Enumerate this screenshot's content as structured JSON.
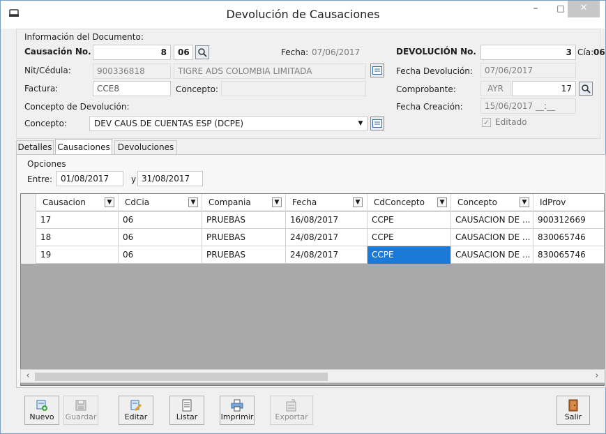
{
  "window": {
    "title": "Devolución de Causaciones",
    "min": "–",
    "max": "□",
    "close": "✕"
  },
  "doc_info": {
    "group_label": "Información del Documento:",
    "causacion_label": "Causación No.",
    "causacion_no": "8",
    "causacion_cia": "06",
    "fecha_label": "Fecha:",
    "fecha_value": "07/06/2017",
    "nit_label": "Nit/Cédula:",
    "nit_value": "900336818",
    "nit_name": "TIGRE ADS COLOMBIA LIMITADA",
    "factura_label": "Factura:",
    "factura_value": "CCE8",
    "concepto_label": "Concepto:",
    "concepto_value": ""
  },
  "concepto_dev": {
    "group_label": "Concepto de Devolución:",
    "label": "Concepto:",
    "value": "DEV CAUS DE CUENTAS ESP (DCPE)"
  },
  "devolucion": {
    "no_label": "DEVOLUCIÓN No.",
    "no_value": "3",
    "cia_label": "Cía:",
    "cia_value": "06",
    "fecha_dev_label": "Fecha Devolución:",
    "fecha_dev_value": "07/06/2017",
    "comprobante_label": "Comprobante:",
    "comprobante_code": "AYR",
    "comprobante_no": "17",
    "fecha_creacion_label": "Fecha Creación:",
    "fecha_creacion_value": "15/06/2017 __:__",
    "editado_label": "Editado",
    "editado_check": "✓"
  },
  "tabs": [
    "Detalles",
    "Causaciones",
    "Devoluciones"
  ],
  "opciones": {
    "label": "Opciones",
    "entre_label": "Entre:",
    "desde": "01/08/2017",
    "y_label": "y",
    "hasta": "31/08/2017"
  },
  "grid": {
    "columns": [
      "Causacion",
      "CdCia",
      "Compania",
      "Fecha",
      "CdConcepto",
      "Concepto",
      "IdProv"
    ],
    "rows": [
      [
        "17",
        "06",
        "PRUEBAS",
        "16/08/2017",
        "CCPE",
        "CAUSACION DE ...",
        "900312669"
      ],
      [
        "18",
        "06",
        "PRUEBAS",
        "24/08/2017",
        "CCPE",
        "CAUSACION DE ...",
        "830065746"
      ],
      [
        "19",
        "06",
        "PRUEBAS",
        "24/08/2017",
        "CCPE",
        "CAUSACION DE ...",
        "830065746"
      ]
    ],
    "selected": {
      "row": 2,
      "col": 4
    }
  },
  "toolbar": {
    "nuevo": "Nuevo",
    "guardar": "Guardar",
    "editar": "Editar",
    "listar": "Listar",
    "imprimir": "Imprimir",
    "exportar": "Exportar",
    "salir": "Salir"
  },
  "colors": {
    "selection": "#1a79d9",
    "grid_bg": "#a9a9a9"
  }
}
